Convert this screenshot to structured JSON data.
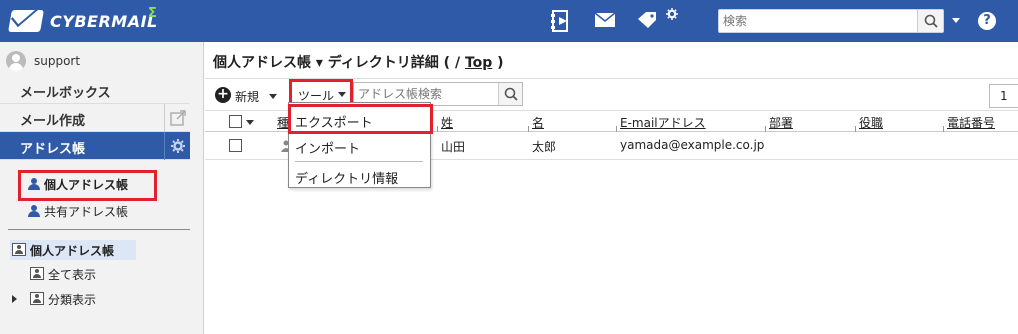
{
  "header": {
    "logo_text": "CYBERMAIL",
    "logo_sigma": "Σ",
    "search_placeholder": "検索",
    "help_label": "?",
    "accent": "#2f5aa8",
    "icons": [
      "directory-icon",
      "mail-icon",
      "tag-icon",
      "gear-small-icon",
      "search-icon",
      "help-icon"
    ]
  },
  "sidebar": {
    "username": "support",
    "nav": [
      {
        "label": "メールボックス"
      },
      {
        "label": "メール作成"
      },
      {
        "label": "アドレス帳"
      }
    ],
    "address_books": [
      {
        "label": "個人アドレス帳"
      },
      {
        "label": "共有アドレス帳"
      }
    ],
    "tree": [
      {
        "label": "個人アドレス帳"
      },
      {
        "label": "全て表示"
      },
      {
        "label": "分類表示"
      }
    ]
  },
  "main": {
    "title_prefix": "個人アドレス帳 ▾ ディレクトリ詳細 ( / ",
    "title_link": "Top",
    "title_suffix": " )",
    "toolbar": {
      "new_label": "新規",
      "tool_label": "ツール",
      "search_placeholder": "アドレス帳検索",
      "page": "1"
    },
    "columns": [
      "種",
      "姓",
      "名",
      "E-mailアドレス",
      "部署",
      "役職",
      "電話番号"
    ],
    "rows": [
      {
        "last": "山田",
        "first": "太郎",
        "email": "yamada@example.co.jp"
      }
    ],
    "menu": [
      {
        "label": "エクスポート"
      },
      {
        "label": "インポート"
      },
      {
        "label": "ディレクトリ情報"
      }
    ]
  },
  "highlight_color": "#e3202e"
}
